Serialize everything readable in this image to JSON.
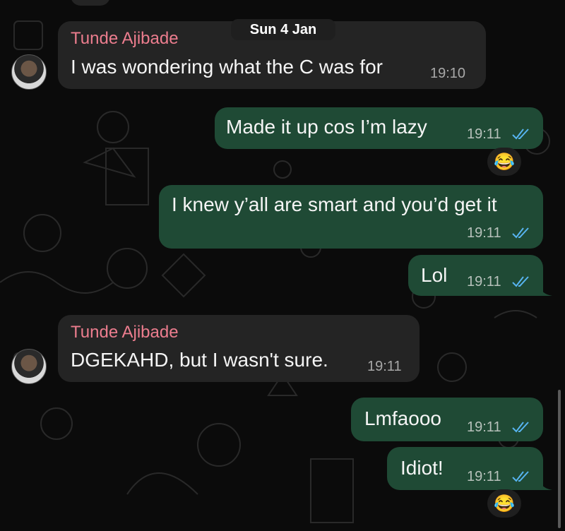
{
  "chat": {
    "date_label": "Sun 4 Jan",
    "messages": [
      {
        "direction": "incoming",
        "sender": "Tunde Ajibade",
        "text": "I was wondering what the C was for",
        "time": "19:10"
      },
      {
        "direction": "outgoing",
        "text": "Made it up cos I’m lazy",
        "time": "19:11",
        "status": "read",
        "reaction": "😂"
      },
      {
        "direction": "outgoing",
        "text": "I knew y’all are smart and you’d get it",
        "time": "19:11",
        "status": "read"
      },
      {
        "direction": "outgoing",
        "text": "Lol",
        "time": "19:11",
        "status": "read"
      },
      {
        "direction": "incoming",
        "sender": "Tunde Ajibade",
        "text": "DGEKAHD, but I wasn't sure.",
        "time": "19:11"
      },
      {
        "direction": "outgoing",
        "text": "Lmfaooo",
        "time": "19:11",
        "status": "read"
      },
      {
        "direction": "outgoing",
        "text": "Idiot!",
        "time": "19:11",
        "status": "read",
        "reaction": "😂"
      }
    ]
  },
  "colors": {
    "background": "#0b0b0b",
    "incoming_bubble": "#242424",
    "outgoing_bubble": "#1f4a35",
    "sender_name": "#ec7d8e",
    "read_ticks": "#57b4f0"
  },
  "icons": {
    "read_receipt": "double-check-icon",
    "avatar": "contact-avatar"
  }
}
